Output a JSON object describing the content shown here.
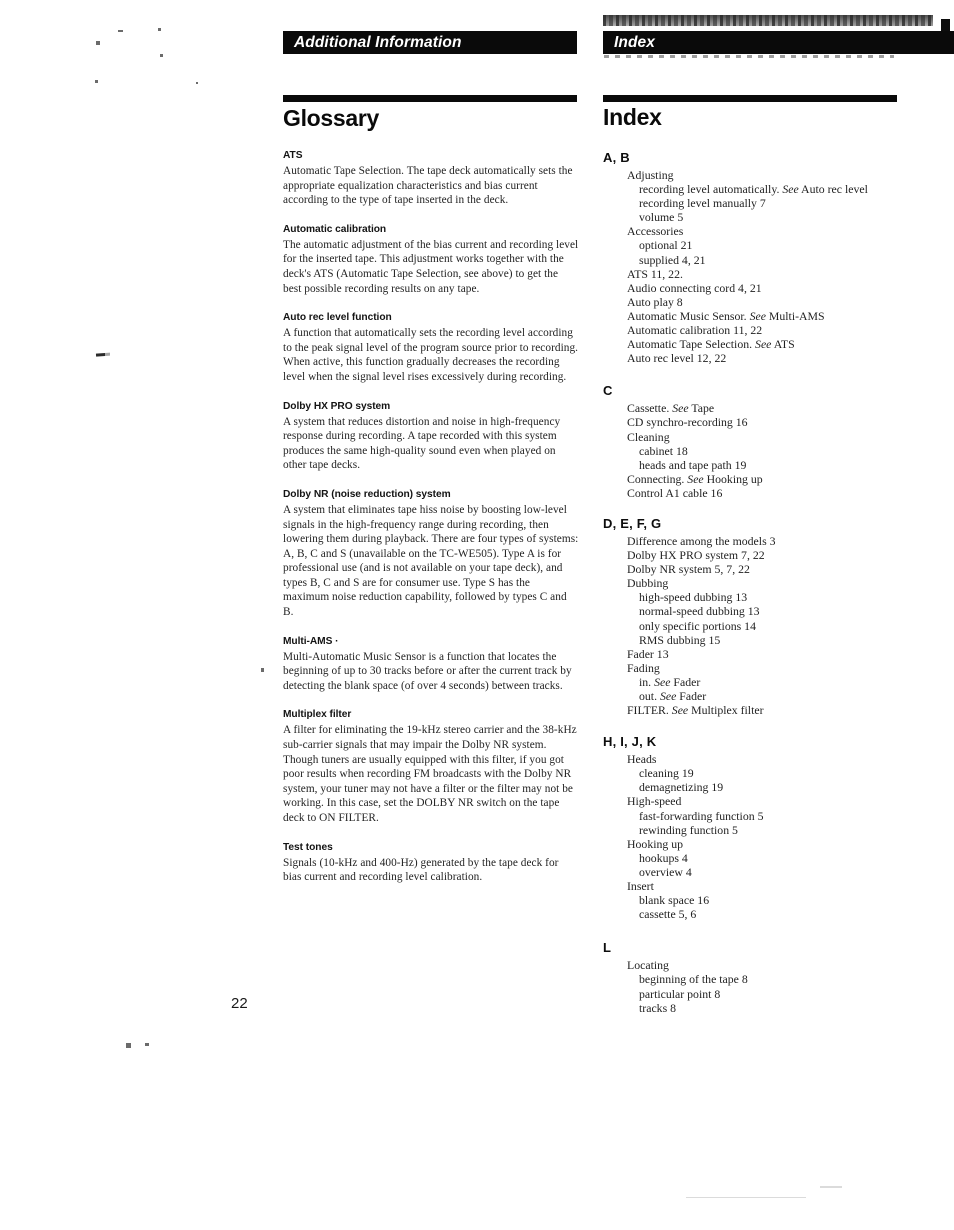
{
  "document": {
    "page_number": "22",
    "running_head_left": "Additional Information",
    "running_head_right": "Index"
  },
  "glossary": {
    "title": "Glossary",
    "entries": [
      {
        "term": "ATS",
        "definition": "Automatic Tape Selection.  The tape deck automatically sets the appropriate equalization characteristics and bias current according to the type of tape inserted in the deck."
      },
      {
        "term": "Automatic calibration",
        "definition": "The automatic adjustment of the bias current and recording level for the inserted tape. This adjustment works together with the deck's ATS (Automatic Tape Selection, see above) to get the best possible recording results on any tape."
      },
      {
        "term": "Auto rec level function",
        "definition": "A function that automatically sets the recording level according to the peak signal level of the program source prior to recording. When active, this function gradually decreases the recording level when the signal level rises excessively during recording."
      },
      {
        "term": "Dolby HX PRO system",
        "definition": "A system that reduces distortion and noise in high-frequency response during recording.  A tape recorded with this system produces the same high-quality sound even when played on other tape decks."
      },
      {
        "term": "Dolby NR (noise reduction) system",
        "definition": "A system that eliminates tape hiss noise by boosting low-level signals in the high-frequency range during recording, then lowering them during playback. There are four types of systems:  A, B, C and S (unavailable on the TC-WE505).  Type A is for professional use (and is not available on your tape deck), and types B, C and S are for consumer use.  Type S has the maximum noise reduction capability, followed by types C and B."
      },
      {
        "term": "Multi-AMS  ·",
        "definition": "Multi-Automatic Music Sensor is a function that locates the beginning of up to 30 tracks before or after the current track by detecting the blank space (of over 4 seconds) between tracks."
      },
      {
        "term": "Multiplex filter",
        "definition": "A filter for eliminating the 19-kHz stereo carrier and the 38-kHz sub-carrier signals that may impair the Dolby NR system.  Though tuners are usually equipped with this filter, if you got poor results when recording FM broadcasts with the Dolby NR system, your tuner may not have a filter or the filter may not be working.  In this case, set the DOLBY NR switch on the tape deck to ON FILTER."
      },
      {
        "term": "Test tones",
        "definition": "Signals (10-kHz and 400-Hz) generated by the tape deck for bias current and recording level calibration."
      }
    ]
  },
  "index": {
    "title": "Index",
    "groups": [
      {
        "letter": "A, B",
        "items": [
          {
            "level": 1,
            "text": "Adjusting"
          },
          {
            "level": 2,
            "text": "recording level automatically.  See Auto rec level",
            "italic_prefix": "recording level automatically.  ",
            "italic_word": "See",
            "italic_suffix": " Auto rec level"
          },
          {
            "level": 2,
            "text": "recording level manually  7"
          },
          {
            "level": 2,
            "text": "volume  5"
          },
          {
            "level": 1,
            "text": "Accessories"
          },
          {
            "level": 2,
            "text": "optional  21"
          },
          {
            "level": 2,
            "text": "supplied  4, 21"
          },
          {
            "level": 1,
            "text": "ATS  11, 22."
          },
          {
            "level": 1,
            "text": "Audio connecting cord  4, 21"
          },
          {
            "level": 1,
            "text": "Auto play  8"
          },
          {
            "level": 1,
            "text": "Automatic Music Sensor.  See Multi-AMS",
            "italic_prefix": "Automatic Music Sensor.  ",
            "italic_word": "See",
            "italic_suffix": " Multi-AMS"
          },
          {
            "level": 1,
            "text": "Automatic calibration  11, 22"
          },
          {
            "level": 1,
            "text": "Automatic Tape Selection.  See ATS",
            "italic_prefix": "Automatic Tape Selection.  ",
            "italic_word": "See",
            "italic_suffix": " ATS"
          },
          {
            "level": 1,
            "text": "Auto rec level  12, 22"
          }
        ]
      },
      {
        "letter": "C",
        "items": [
          {
            "level": 1,
            "text": "Cassette.  See Tape",
            "italic_prefix": "Cassette.  ",
            "italic_word": "See",
            "italic_suffix": " Tape"
          },
          {
            "level": 1,
            "text": "CD synchro-recording  16"
          },
          {
            "level": 1,
            "text": "Cleaning"
          },
          {
            "level": 2,
            "text": "cabinet  18"
          },
          {
            "level": 2,
            "text": "heads and tape path  19"
          },
          {
            "level": 1,
            "text": "Connecting.  See Hooking up",
            "italic_prefix": "Connecting.  ",
            "italic_word": "See",
            "italic_suffix": " Hooking up"
          },
          {
            "level": 1,
            "text": "Control A1 cable  16"
          }
        ]
      },
      {
        "letter": "D, E, F, G",
        "items": [
          {
            "level": 1,
            "text": "Difference among the models  3"
          },
          {
            "level": 1,
            "text": "Dolby HX PRO system  7, 22"
          },
          {
            "level": 1,
            "text": "Dolby NR system  5, 7, 22"
          },
          {
            "level": 1,
            "text": "Dubbing"
          },
          {
            "level": 2,
            "text": "high-speed dubbing  13"
          },
          {
            "level": 2,
            "text": "normal-speed dubbing  13"
          },
          {
            "level": 2,
            "text": "only specific portions  14"
          },
          {
            "level": 2,
            "text": "RMS dubbing  15"
          },
          {
            "level": 1,
            "text": "Fader  13"
          },
          {
            "level": 1,
            "text": "Fading"
          },
          {
            "level": 2,
            "text": "in.  See Fader",
            "italic_prefix": "in.  ",
            "italic_word": "See",
            "italic_suffix": " Fader"
          },
          {
            "level": 2,
            "text": "out.  See Fader",
            "italic_prefix": "out.  ",
            "italic_word": "See",
            "italic_suffix": " Fader"
          },
          {
            "level": 1,
            "text": "FILTER.  See Multiplex filter",
            "italic_prefix": "FILTER.  ",
            "italic_word": "See",
            "italic_suffix": " Multiplex filter"
          }
        ]
      },
      {
        "letter": "H, I, J, K",
        "items": [
          {
            "level": 1,
            "text": "Heads"
          },
          {
            "level": 2,
            "text": "cleaning  19"
          },
          {
            "level": 2,
            "text": "demagnetizing  19"
          },
          {
            "level": 1,
            "text": "High-speed"
          },
          {
            "level": 2,
            "text": "fast-forwarding function  5"
          },
          {
            "level": 2,
            "text": "rewinding function  5"
          },
          {
            "level": 1,
            "text": "Hooking up"
          },
          {
            "level": 2,
            "text": "hookups  4"
          },
          {
            "level": 2,
            "text": "overview  4"
          },
          {
            "level": 1,
            "text": "Insert"
          },
          {
            "level": 2,
            "text": "blank space  16"
          },
          {
            "level": 2,
            "text": "cassette  5, 6"
          }
        ]
      },
      {
        "letter": "L",
        "items": [
          {
            "level": 1,
            "text": "Locating"
          },
          {
            "level": 2,
            "text": "beginning of the tape  8"
          },
          {
            "level": 2,
            "text": "particular point  8"
          },
          {
            "level": 2,
            "text": "tracks  8"
          }
        ]
      }
    ]
  }
}
